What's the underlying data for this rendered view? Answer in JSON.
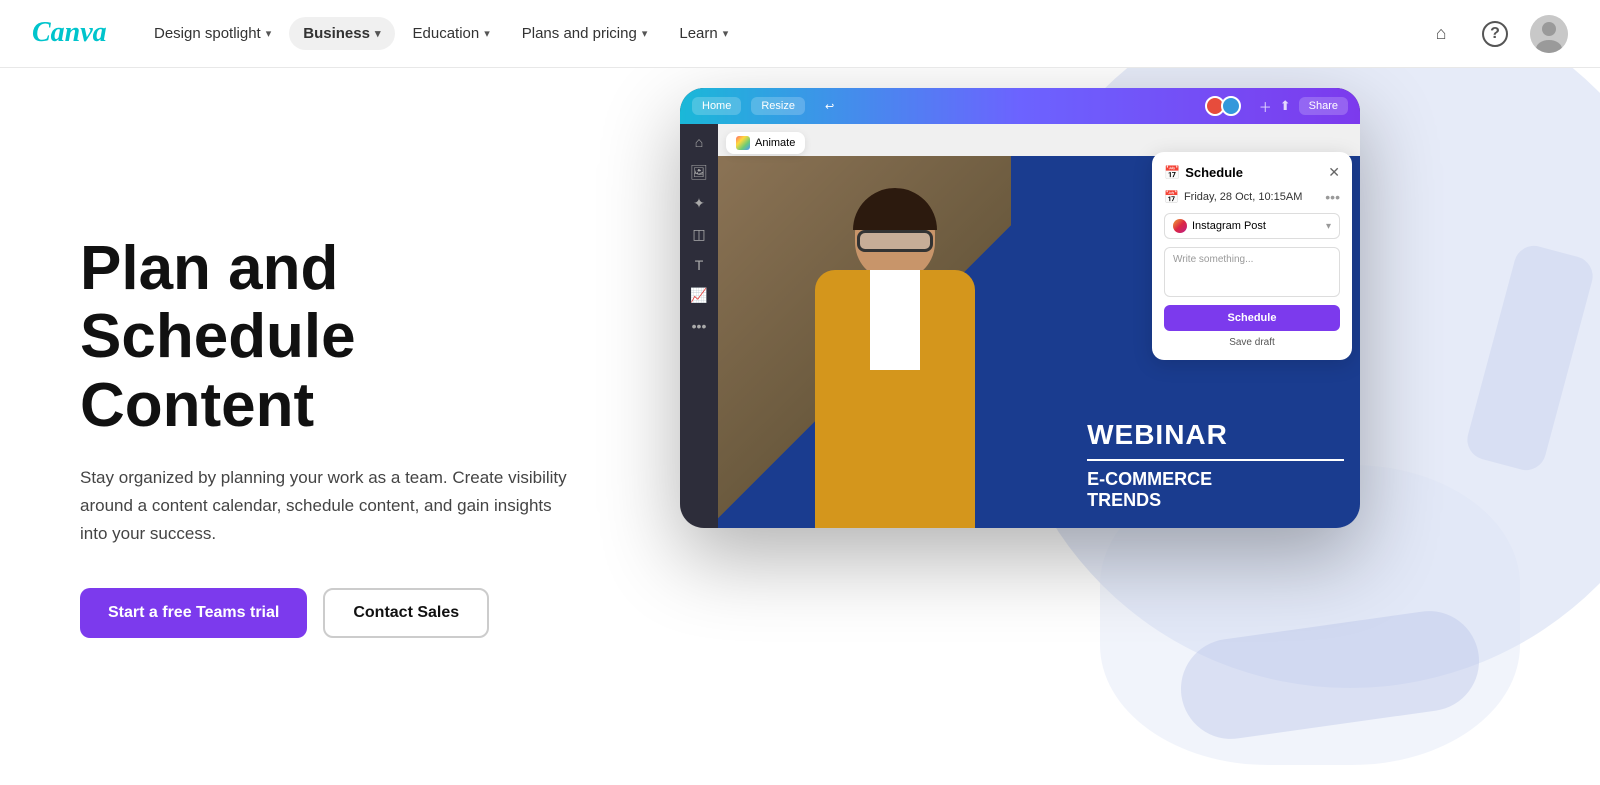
{
  "nav": {
    "logo_text": "Canva",
    "items": [
      {
        "id": "design-spotlight",
        "label": "Design spotlight",
        "has_chevron": true,
        "active": false
      },
      {
        "id": "business",
        "label": "Business",
        "has_chevron": true,
        "active": true
      },
      {
        "id": "education",
        "label": "Education",
        "has_chevron": true,
        "active": false
      },
      {
        "id": "plans-pricing",
        "label": "Plans and pricing",
        "has_chevron": true,
        "active": false
      },
      {
        "id": "learn",
        "label": "Learn",
        "has_chevron": true,
        "active": false
      }
    ]
  },
  "hero": {
    "title": "Plan and Schedule Content",
    "description": "Stay organized by planning your work as a team. Create visibility around a content calendar, schedule content, and gain insights into your success.",
    "cta_primary": "Start a free Teams trial",
    "cta_secondary": "Contact Sales"
  },
  "mockup": {
    "topbar_btn1": "Home",
    "topbar_btn2": "Resize",
    "topbar_btn3_icon": "↩",
    "share_label": "Share",
    "animate_label": "Animate",
    "schedule_title": "Schedule",
    "schedule_date": "Friday, 28 Oct, 10:15AM",
    "platform_label": "Instagram Post",
    "write_placeholder": "Write something...",
    "schedule_btn": "Schedule",
    "save_draft": "Save draft",
    "webinar_title": "WEBINAR",
    "webinar_subtitle1": "E-COMMERCE",
    "webinar_subtitle2": "TRENDS"
  }
}
